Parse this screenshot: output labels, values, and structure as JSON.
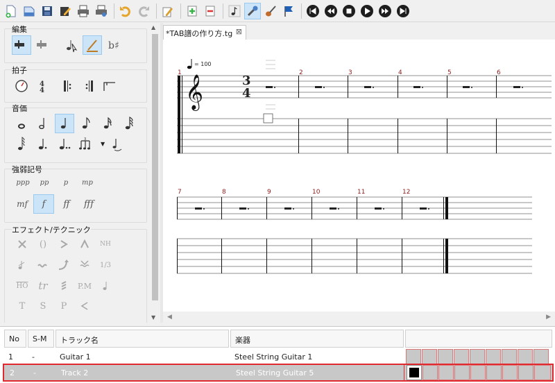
{
  "toolbar": {
    "buttons": [
      "new-file-icon",
      "open-file-icon",
      "save-icon",
      "edit-icon",
      "print-icon",
      "print-preview-icon",
      "undo-icon",
      "redo-icon",
      "pencil-icon",
      "insert-measure-icon",
      "remove-measure-icon",
      "note-icon",
      "wrench-icon",
      "guitar-icon",
      "flag-icon",
      "first-icon",
      "rewind-icon",
      "stop-icon",
      "play-icon",
      "fast-forward-icon",
      "last-icon"
    ]
  },
  "palette": {
    "sections": {
      "edit": "編集",
      "time": "拍子",
      "duration": "音価",
      "dynamics": "強弱記号",
      "effects": "エフェクト/テクニック"
    },
    "edit_voice1": "1",
    "edit_voice2": "2",
    "time_sig_top": "4",
    "time_sig_bottom": "4",
    "dynamics": [
      "ppp",
      "pp",
      "p",
      "mp",
      "mf",
      "f",
      "ff",
      "fff"
    ],
    "effects": [
      "()",
      "NH",
      "1/3",
      "HO",
      "tr",
      "P.M",
      "T",
      "S",
      "P"
    ]
  },
  "editor": {
    "tab_title": "*TAB譜の作り方.tg",
    "tab_close": "⊠",
    "tempo": "= 100",
    "time_signature": {
      "top": "3",
      "bottom": "4"
    },
    "measure_numbers_row1": [
      "1",
      "2",
      "3",
      "4",
      "5",
      "6"
    ],
    "measure_numbers_row2": [
      "7",
      "8",
      "9",
      "10",
      "11",
      "12"
    ]
  },
  "tracks": {
    "headers": {
      "no": "No",
      "sm": "S-M",
      "name": "トラック名",
      "instrument": "楽器"
    },
    "rows": [
      {
        "no": "1",
        "sm": "-",
        "name": "Guitar 1",
        "instrument": "Steel String Guitar 1"
      },
      {
        "no": "2",
        "sm": "-",
        "name": "Track 2",
        "instrument": "Steel String Guitar 5"
      }
    ]
  },
  "colors": {
    "accent": "#cce4f7",
    "selection_border": "#e0282e",
    "measure_number": "#8b1a1a"
  }
}
